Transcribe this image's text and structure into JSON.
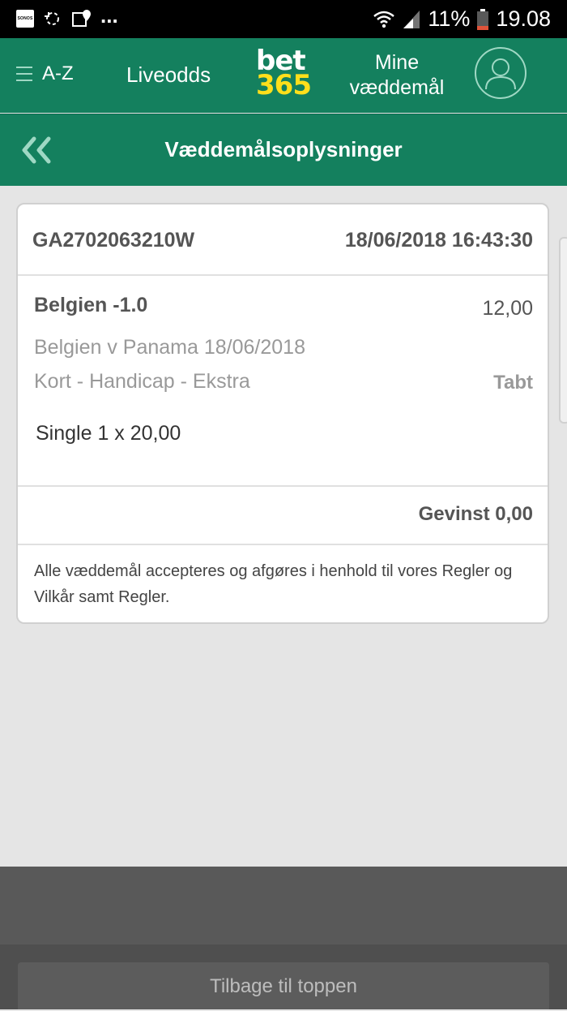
{
  "statusbar": {
    "sonos": "SONOS",
    "dots": "...",
    "battery": "11%",
    "time": "19.08"
  },
  "header": {
    "az": "A-Z",
    "liveodds": "Liveodds",
    "logo_top": "bet",
    "logo_bottom": "365",
    "mine_line1": "Mine",
    "mine_line2": "væddemål"
  },
  "titlebar": {
    "title": "Væddemålsoplysninger"
  },
  "bet": {
    "reference": "GA2702063210W",
    "datetime": "18/06/2018 16:43:30",
    "selection": "Belgien -1.0",
    "odds": "12,00",
    "event": "Belgien v Panama 18/06/2018",
    "market": "Kort - Handicap - Ekstra",
    "status": "Tabt",
    "stake": "Single 1 x 20,00",
    "winnings": "Gevinst 0,00",
    "terms": "Alle væddemål accepteres og afgøres i henhold til vores Regler og Vilkår samt Regler."
  },
  "footer": {
    "back_to_top": "Tilbage til toppen"
  },
  "colors": {
    "brand_green": "#14805e",
    "logo_yellow": "#ffdf1b",
    "page_bg": "#e5e5e5"
  }
}
